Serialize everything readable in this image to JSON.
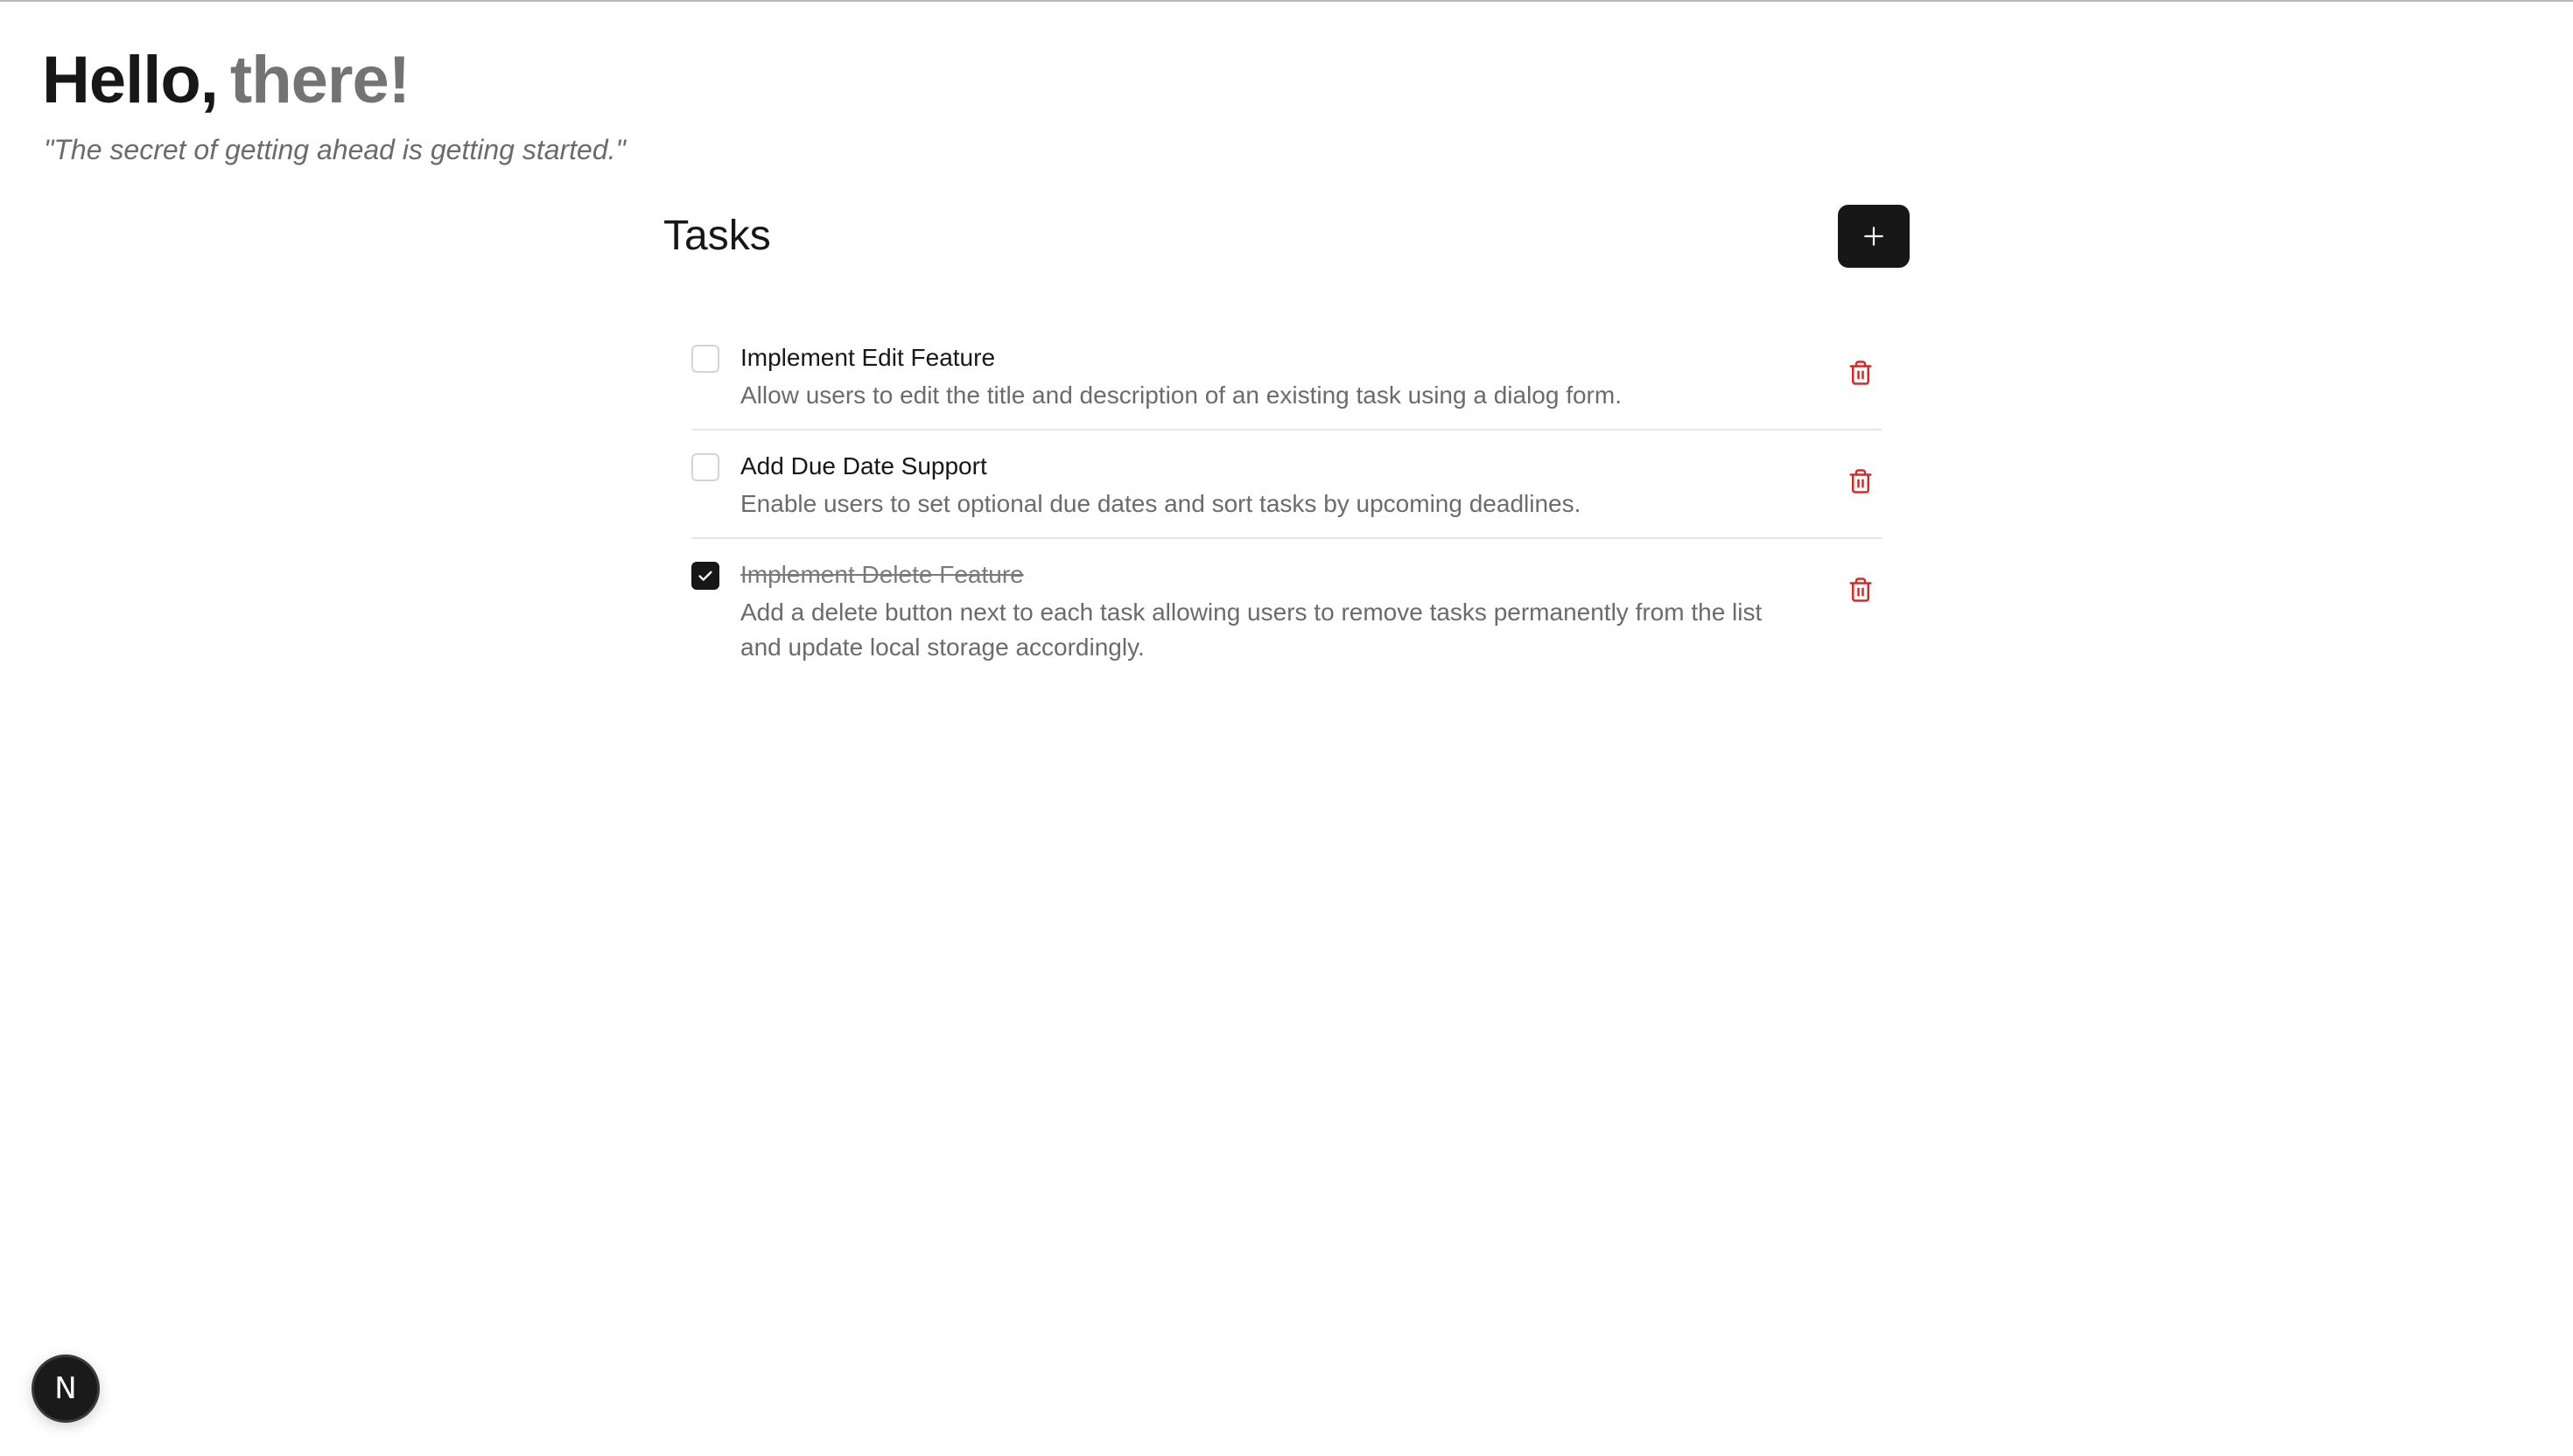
{
  "greeting": {
    "hello": "Hello,",
    "name": "there!"
  },
  "quote": "\"The secret of getting ahead is getting started.\"",
  "tasks": {
    "title": "Tasks",
    "add_icon": "plus-icon",
    "items": [
      {
        "title": "Implement Edit Feature",
        "description": "Allow users to edit the title and description of an existing task using a dialog form.",
        "completed": false
      },
      {
        "title": "Add Due Date Support",
        "description": "Enable users to set optional due dates and sort tasks by upcoming deadlines.",
        "completed": false
      },
      {
        "title": "Implement Delete Feature",
        "description": "Add a delete button next to each task allowing users to remove tasks permanently from the list and update local storage accordingly.",
        "completed": true
      }
    ]
  },
  "dev_badge": {
    "letter": "N"
  },
  "colors": {
    "primary": "#171717",
    "muted": "#737373",
    "danger": "#dc2626",
    "border": "#e5e5e5"
  }
}
